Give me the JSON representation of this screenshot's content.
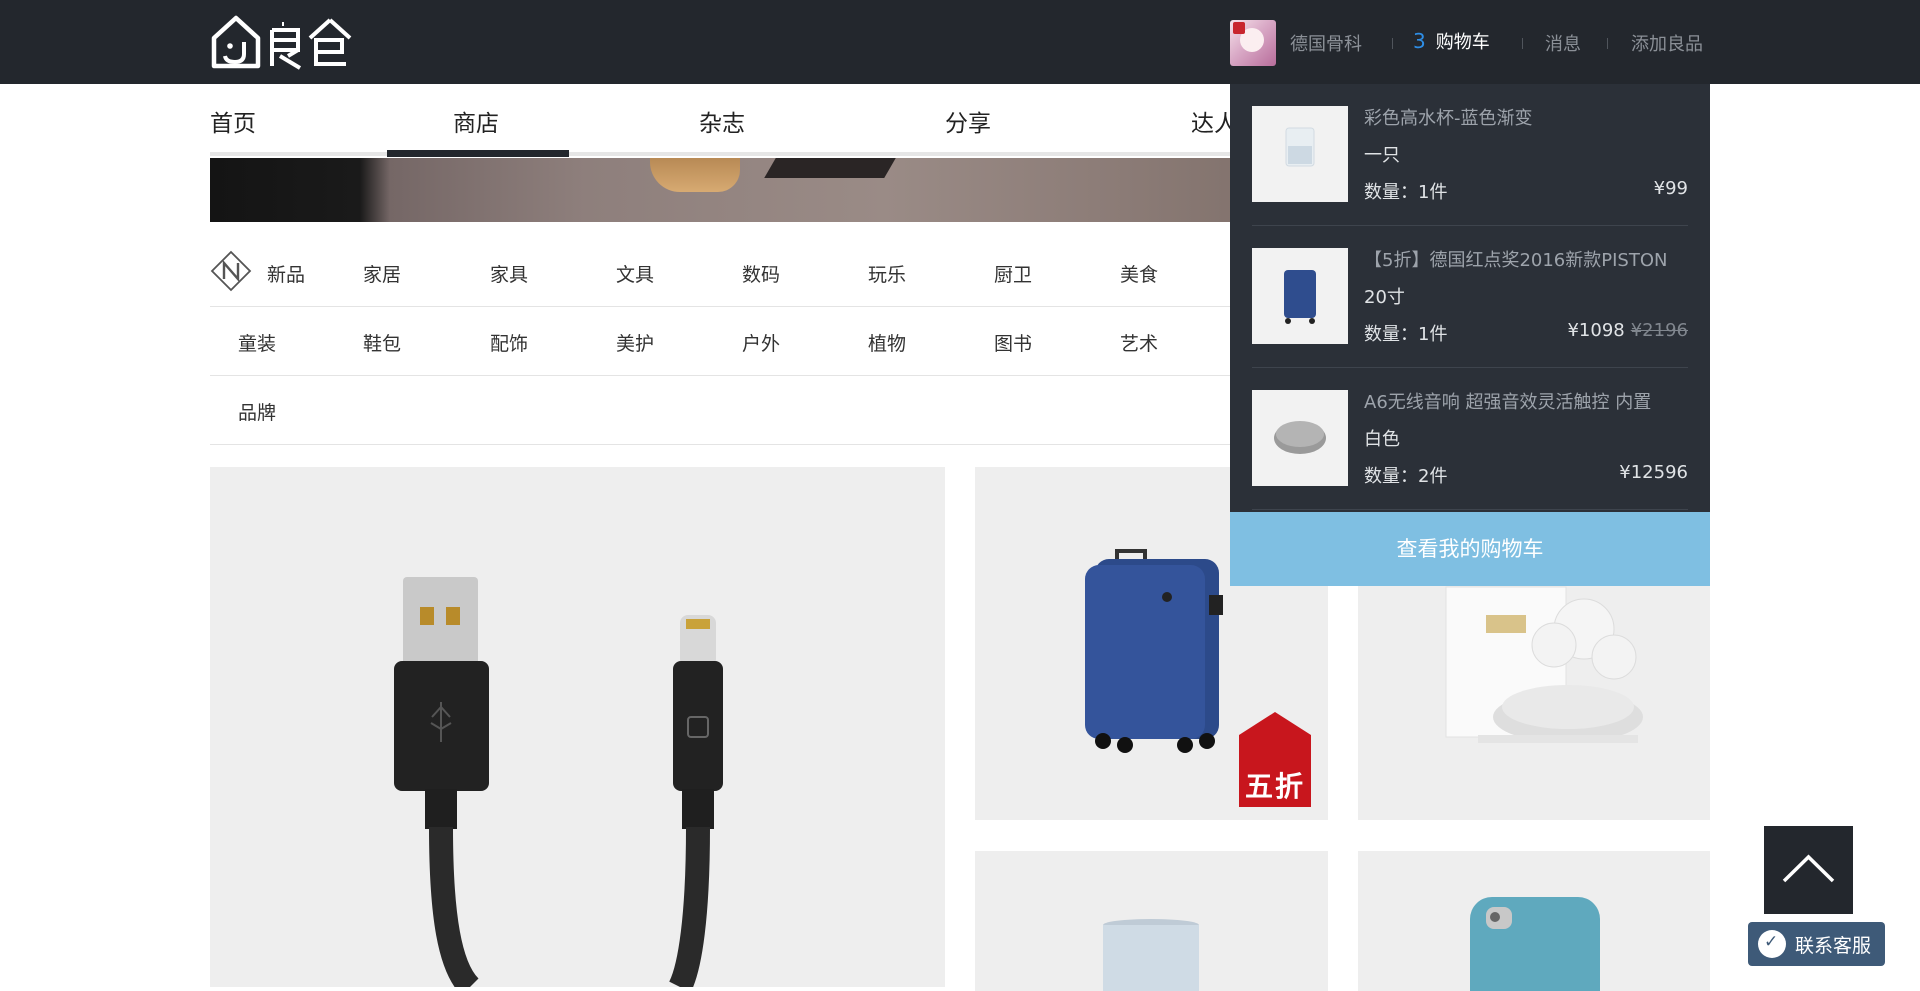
{
  "header": {
    "logo_text": "良仓",
    "username": "德国骨科",
    "cart_count": "3",
    "cart_label": "购物车",
    "messages_label": "消息",
    "add_label": "添加良品"
  },
  "nav": {
    "items": [
      "首页",
      "商店",
      "杂志",
      "分享",
      "达人"
    ],
    "active": "商店"
  },
  "categories": {
    "row1": [
      "新品",
      "家居",
      "家具",
      "文具",
      "数码",
      "玩乐",
      "厨卫",
      "美食"
    ],
    "row2": [
      "童装",
      "鞋包",
      "配饰",
      "美护",
      "户外",
      "植物",
      "图书",
      "艺术"
    ],
    "row3": [
      "品牌"
    ]
  },
  "products": {
    "suitcase_badge": "五折"
  },
  "cart": {
    "items": [
      {
        "name": "彩色高水杯-蓝色渐变",
        "variant": "一只",
        "qty": "数量：1件",
        "price": "¥99",
        "old_price": ""
      },
      {
        "name": "【5折】德国红点奖2016新款PISTON",
        "variant": "20寸",
        "qty": "数量：1件",
        "price": "¥1098",
        "old_price": "¥2196"
      },
      {
        "name": "A6无线音响 超强音效灵活触控 内置",
        "variant": "白色",
        "qty": "数量：2件",
        "price": "¥12596",
        "old_price": ""
      }
    ],
    "view_cart_label": "查看我的购物车"
  },
  "floating": {
    "service_label": "联系客服"
  },
  "colors": {
    "header_bg": "#23272d",
    "cart_bg": "#2b3038",
    "cart_button": "#7fbfe2",
    "accent_count": "#2e8ee6",
    "badge_red": "#c8161d"
  }
}
